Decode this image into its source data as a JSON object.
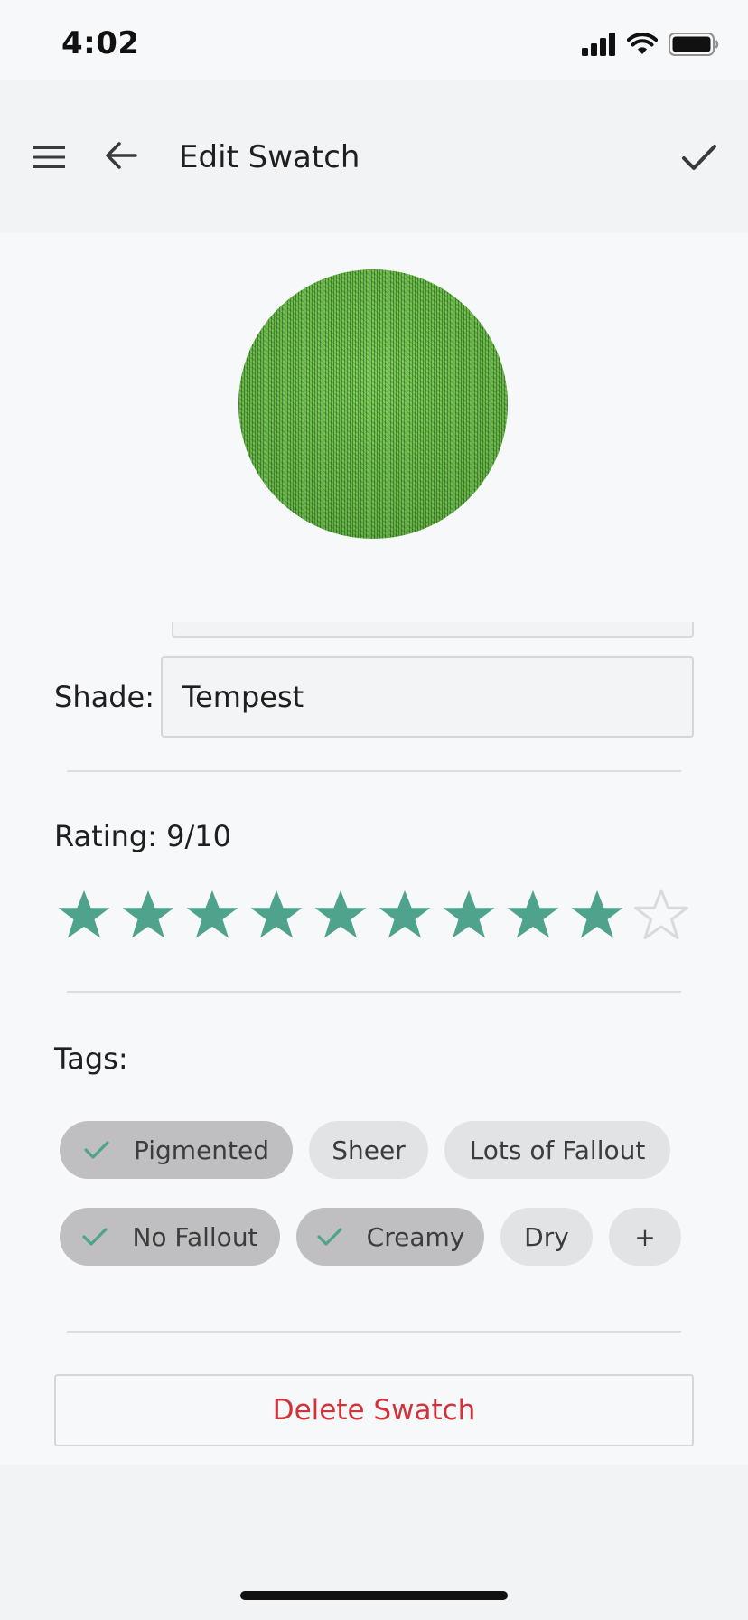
{
  "status_bar": {
    "time": "4:02"
  },
  "app_bar": {
    "title": "Edit Swatch"
  },
  "swatch": {
    "color": "#6cc24a"
  },
  "shade": {
    "label": "Shade:",
    "value": "Tempest"
  },
  "rating": {
    "label": "Rating: 9/10",
    "value": 9,
    "max": 10,
    "star_color": "#4fa38d",
    "empty_star_color": "#dadadb"
  },
  "tags": {
    "label": "Tags:",
    "items": [
      {
        "label": "Pigmented",
        "selected": true
      },
      {
        "label": "Sheer",
        "selected": false
      },
      {
        "label": "Lots of Fallout",
        "selected": false
      },
      {
        "label": "No Fallout",
        "selected": true
      },
      {
        "label": "Creamy",
        "selected": true
      },
      {
        "label": "Dry",
        "selected": false
      }
    ],
    "add_label": "+",
    "check_color": "#4fa38d"
  },
  "actions": {
    "delete_label": "Delete Swatch",
    "delete_color": "#d0333a"
  }
}
